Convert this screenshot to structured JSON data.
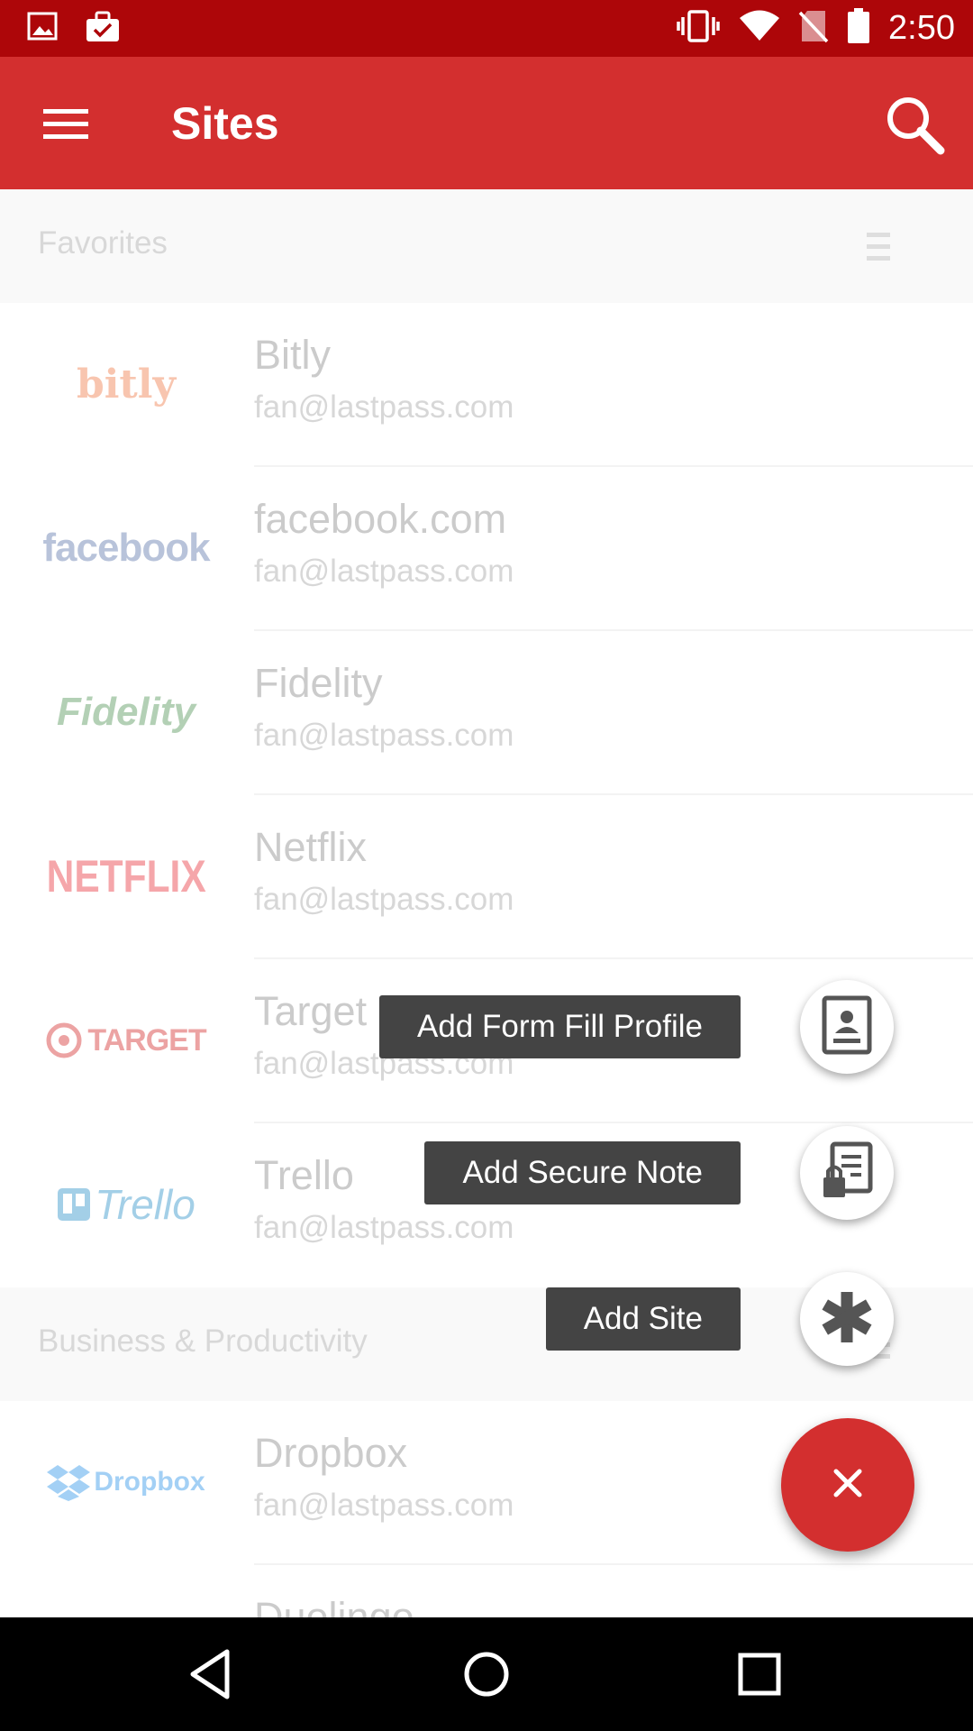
{
  "status_bar": {
    "time": "2:50",
    "icons_left": [
      "gallery-icon",
      "briefcase-icon"
    ],
    "icons_right": [
      "vibrate-icon",
      "wifi-icon",
      "no-sim-icon",
      "battery-icon"
    ]
  },
  "app_bar": {
    "title": "Sites",
    "menu_icon": "hamburger-menu-icon",
    "search_icon": "search-icon",
    "color": "#d32f2f",
    "status_color": "#ad0609"
  },
  "sections": [
    {
      "title": "Favorites",
      "items": [
        {
          "logo_text": "bitly",
          "name": "Bitly",
          "user": "fan@lastpass.com"
        },
        {
          "logo_text": "facebook",
          "name": "facebook.com",
          "user": "fan@lastpass.com"
        },
        {
          "logo_text": "Fidelity",
          "name": "Fidelity",
          "user": "fan@lastpass.com"
        },
        {
          "logo_text": "NETFLIX",
          "name": "Netflix",
          "user": "fan@lastpass.com"
        },
        {
          "logo_text": "TARGET",
          "name": "Target",
          "user": "fan@lastpass.com"
        },
        {
          "logo_text": "Trello",
          "name": "Trello",
          "user": "fan@lastpass.com"
        }
      ]
    },
    {
      "title": "Business & Productivity",
      "items": [
        {
          "logo_text": "Dropbox",
          "name": "Dropbox",
          "user": "fan@lastpass.com"
        },
        {
          "logo_text": "",
          "name": "Duolingo",
          "user": ""
        }
      ]
    }
  ],
  "fab_menu": {
    "actions": [
      {
        "label": "Add Form Fill Profile",
        "icon": "form-fill-profile-icon"
      },
      {
        "label": "Add Secure Note",
        "icon": "secure-note-icon"
      },
      {
        "label": "Add Site",
        "icon": "asterisk-icon"
      }
    ],
    "close_label": "×"
  },
  "nav_bar": {
    "buttons": [
      "back-icon",
      "home-icon",
      "recents-icon"
    ]
  }
}
